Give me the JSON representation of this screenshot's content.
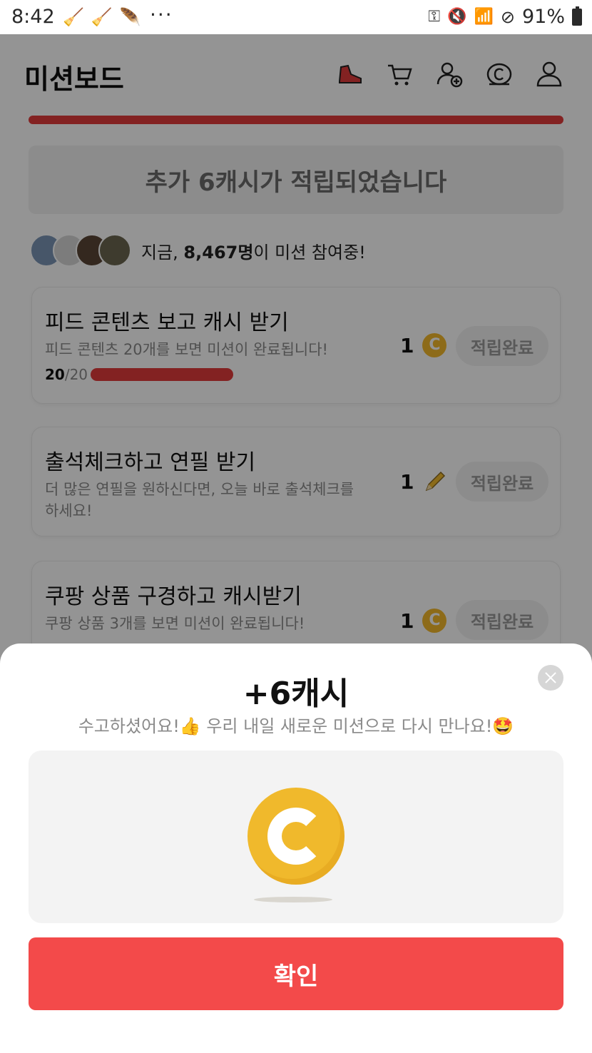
{
  "status_bar": {
    "time": "8:42",
    "dots": "···",
    "battery_percent": "91%"
  },
  "header": {
    "title": "미션보드"
  },
  "banner": {
    "text": "추가 6캐시가 적립되었습니다"
  },
  "participants": {
    "prefix": "지금, ",
    "count": "8,467명",
    "suffix": "이 미션 참여중!"
  },
  "missions": [
    {
      "title": "피드 콘텐츠 보고 캐시 받기",
      "desc": "피드 콘텐츠 20개를 보면 미션이 완료됩니다!",
      "progress_current": "20",
      "progress_total": "/20",
      "reward_amount": "1",
      "reward_type": "cash-coin-icon",
      "status": "적립완료"
    },
    {
      "title": "출석체크하고 연필 받기",
      "desc": "더 많은 연필을 원하신다면, 오늘 바로 출석체크를 하세요!",
      "reward_amount": "1",
      "reward_type": "pencil-icon",
      "status": "적립완료"
    },
    {
      "title": "쿠팡 상품 구경하고 캐시받기",
      "desc": "쿠팡 상품 3개를 보면 미션이 완료됩니다!",
      "reward_amount": "1",
      "reward_type": "cash-coin-icon",
      "status": "적립완료"
    }
  ],
  "sheet": {
    "title": "+6캐시",
    "subtitle": "수고하셨어요!👍 우리 내일 새로운 미션으로 다시 만나요!🤩",
    "confirm_label": "확인"
  },
  "colors": {
    "accent": "#f34a4a",
    "progress": "#e23c3c",
    "coin": "#f0b92c"
  }
}
